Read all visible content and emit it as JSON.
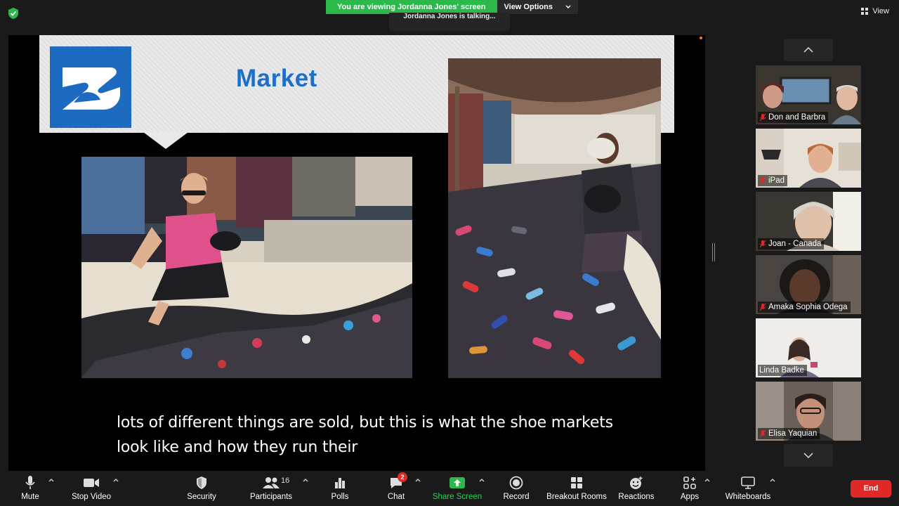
{
  "top_bar": {
    "viewing_banner": "You are viewing Jordanna Jones' screen",
    "view_options_label": "View Options",
    "talking_status": "Jordanna Jones is talking...",
    "view_label": "View"
  },
  "slide": {
    "title": "Market",
    "caption_line1": "lots of different things are sold, but this is what the shoe markets",
    "caption_line2": "look like and how they run their"
  },
  "participants": [
    {
      "name": "Don and Barbra",
      "muted": true
    },
    {
      "name": "iPad",
      "muted": true
    },
    {
      "name": "Joan - Canada",
      "muted": true
    },
    {
      "name": "Amaka Sophia Odega",
      "muted": true
    },
    {
      "name": "Linda Badke",
      "muted": false
    },
    {
      "name": "Elisa Yaquian",
      "muted": true
    }
  ],
  "toolbar": {
    "mute_label": "Mute",
    "stop_video_label": "Stop Video",
    "security_label": "Security",
    "participants_label": "Participants",
    "participants_count": "16",
    "polls_label": "Polls",
    "chat_label": "Chat",
    "chat_badge": "2",
    "share_screen_label": "Share Screen",
    "record_label": "Record",
    "breakout_rooms_label": "Breakout Rooms",
    "reactions_label": "Reactions",
    "apps_label": "Apps",
    "whiteboards_label": "Whiteboards",
    "end_label": "End"
  },
  "colors": {
    "share_green": "#2db84c",
    "end_red": "#e02828",
    "slide_title_blue": "#1e6fc6",
    "logo_blue": "#1d6bc1"
  }
}
